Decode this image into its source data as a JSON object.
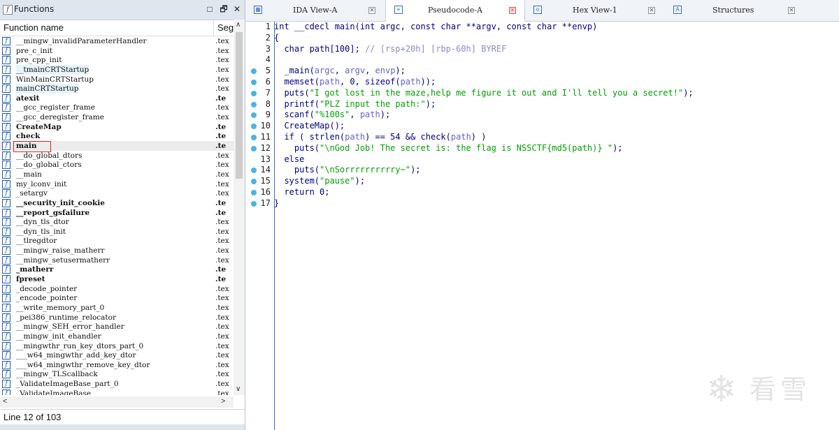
{
  "functions_window": {
    "title": "Functions",
    "controls": {
      "restore": "□",
      "maximize": "🗗",
      "close": "✕"
    },
    "col_name": "Function name",
    "col_segment": "Seg",
    "selected_index": 11,
    "items": [
      {
        "name": "__mingw_invalidParameterHandler",
        "seg": ".tex",
        "style": "normal"
      },
      {
        "name": "pre_c_init",
        "seg": ".tex",
        "style": "normal"
      },
      {
        "name": "pre_cpp_init",
        "seg": ".tex",
        "style": "normal"
      },
      {
        "name": "__tmainCRTStartup",
        "seg": ".tex",
        "style": "hl"
      },
      {
        "name": "WinMainCRTStartup",
        "seg": ".tex",
        "style": "normal"
      },
      {
        "name": "mainCRTStartup",
        "seg": ".tex",
        "style": "hl"
      },
      {
        "name": "atexit",
        "seg": ".te",
        "style": "bold"
      },
      {
        "name": "__gcc_register_frame",
        "seg": ".tex",
        "style": "normal"
      },
      {
        "name": "__gcc_deregister_frame",
        "seg": ".tex",
        "style": "normal"
      },
      {
        "name": "CreateMap",
        "seg": ".te",
        "style": "bold"
      },
      {
        "name": "check",
        "seg": ".te",
        "style": "bold"
      },
      {
        "name": "main",
        "seg": ".te",
        "style": "bold"
      },
      {
        "name": "__do_global_dtors",
        "seg": ".tex",
        "style": "normal"
      },
      {
        "name": "__do_global_ctors",
        "seg": ".tex",
        "style": "normal"
      },
      {
        "name": "__main",
        "seg": ".tex",
        "style": "normal"
      },
      {
        "name": "my_lconv_init",
        "seg": ".tex",
        "style": "normal"
      },
      {
        "name": "_setargv",
        "seg": ".tex",
        "style": "normal"
      },
      {
        "name": "__security_init_cookie",
        "seg": ".te",
        "style": "bold"
      },
      {
        "name": "__report_gsfailure",
        "seg": ".te",
        "style": "bold"
      },
      {
        "name": "__dyn_tls_dtor",
        "seg": ".tex",
        "style": "normal"
      },
      {
        "name": "__dyn_tls_init",
        "seg": ".tex",
        "style": "normal"
      },
      {
        "name": "__tlregdtor",
        "seg": ".tex",
        "style": "normal"
      },
      {
        "name": "__mingw_raise_matherr",
        "seg": ".tex",
        "style": "normal"
      },
      {
        "name": "__mingw_setusermatherr",
        "seg": ".tex",
        "style": "normal"
      },
      {
        "name": "_matherr",
        "seg": ".te",
        "style": "bold"
      },
      {
        "name": "fpreset",
        "seg": ".te",
        "style": "bold"
      },
      {
        "name": "_decode_pointer",
        "seg": ".tex",
        "style": "normal"
      },
      {
        "name": "_encode_pointer",
        "seg": ".tex",
        "style": "normal"
      },
      {
        "name": "__write_memory_part_0",
        "seg": ".tex",
        "style": "normal"
      },
      {
        "name": "_pei386_runtime_relocator",
        "seg": ".tex",
        "style": "normal"
      },
      {
        "name": "__mingw_SEH_error_handler",
        "seg": ".tex",
        "style": "normal"
      },
      {
        "name": "__mingw_init_ehandler",
        "seg": ".tex",
        "style": "normal"
      },
      {
        "name": "__mingwthr_run_key_dtors_part_0",
        "seg": ".tex",
        "style": "normal"
      },
      {
        "name": "___w64_mingwthr_add_key_dtor",
        "seg": ".tex",
        "style": "normal"
      },
      {
        "name": "___w64_mingwthr_remove_key_dtor",
        "seg": ".tex",
        "style": "normal"
      },
      {
        "name": "__mingw_TLScallback",
        "seg": ".tex",
        "style": "normal"
      },
      {
        "name": "_ValidateImageBase_part_0",
        "seg": ".tex",
        "style": "normal"
      },
      {
        "name": "_ValidateImageBase",
        "seg": ".tex",
        "style": "normal"
      }
    ],
    "status": "Line 12 of 103"
  },
  "tabs": [
    {
      "label": "IDA View-A",
      "icon": "ida-view-icon",
      "active": false
    },
    {
      "label": "Pseudocode-A",
      "icon": "pseudocode-icon",
      "active": true
    },
    {
      "label": "Hex View-1",
      "icon": "hex-view-icon",
      "active": false
    },
    {
      "label": "Structures",
      "icon": "structures-icon",
      "active": false
    }
  ],
  "code_lines": [
    {
      "n": "1",
      "bp": false,
      "html": "int __cdecl main(int argc, const char **argv, const char **envp)"
    },
    {
      "n": "2",
      "bp": false,
      "html": "{"
    },
    {
      "n": "3",
      "bp": false,
      "html": "  char path[100]; <span class='c'>// [rsp+20h] [rbp-60h] BYREF</span>"
    },
    {
      "n": "4",
      "bp": false,
      "html": ""
    },
    {
      "n": "5",
      "bp": true,
      "html": "  _main(<span class='v'>argc</span>, <span class='v'>argv</span>, <span class='v'>envp</span>);"
    },
    {
      "n": "6",
      "bp": true,
      "html": "  memset(<span class='v'>path</span>, 0, sizeof(<span class='v'>path</span>));"
    },
    {
      "n": "7",
      "bp": true,
      "html": "  puts(<span class='s'>\"I got lost in the maze,help me figure it out and I'll tell you a secret!\"</span>);"
    },
    {
      "n": "8",
      "bp": true,
      "html": "  printf(<span class='s'>\"PLZ input the path:\"</span>);"
    },
    {
      "n": "9",
      "bp": true,
      "html": "  scanf(<span class='s'>\"%100s\"</span>, <span class='v'>path</span>);"
    },
    {
      "n": "10",
      "bp": true,
      "html": "  CreateMap();"
    },
    {
      "n": "11",
      "bp": true,
      "html": "  if ( strlen(<span class='v'>path</span>) == 54 &amp;&amp; check(<span class='v'>path</span>) )"
    },
    {
      "n": "12",
      "bp": true,
      "html": "    puts(<span class='s'>\"\\nGod Job! The secret is: the flag is NSSCTF{md5(path)} \"</span>);"
    },
    {
      "n": "13",
      "bp": false,
      "html": "  else"
    },
    {
      "n": "14",
      "bp": true,
      "html": "    puts(<span class='s'>\"\\nSorrrrrrrrrry~\"</span>);"
    },
    {
      "n": "15",
      "bp": true,
      "html": "  system(<span class='s'>\"pause\"</span>);"
    },
    {
      "n": "16",
      "bp": true,
      "html": "  return 0;"
    },
    {
      "n": "17",
      "bp": true,
      "html": "}"
    }
  ],
  "watermark": {
    "text": "看雪",
    "icon": "snowflake-logo-icon"
  }
}
